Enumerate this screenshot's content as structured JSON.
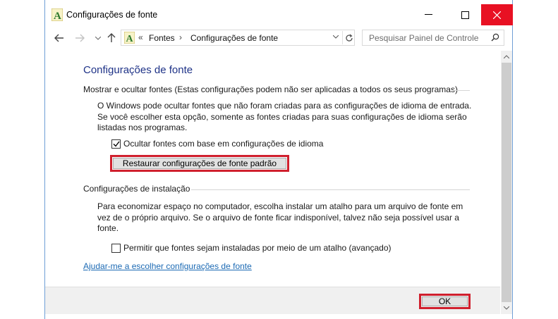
{
  "window": {
    "title": "Configurações de fonte"
  },
  "nav": {
    "back_icon": "arrow-left-icon",
    "forward_icon": "arrow-right-icon",
    "up_icon": "arrow-up-icon",
    "breadcrumb_prefix": "«",
    "breadcrumb": [
      "Fontes",
      "Configurações de fonte"
    ],
    "breadcrumb_separator": "›",
    "search_placeholder": "Pesquisar Painel de Controle"
  },
  "main": {
    "page_title": "Configurações de fonte",
    "section1": {
      "heading": "Mostrar e ocultar fontes (Estas configurações podem não ser aplicadas a todos os seus programas)",
      "description": "O Windows pode ocultar fontes que não foram criadas para as configurações de idioma de entrada. Se você escolher esta opção, somente as fontes criadas para suas configurações de idioma serão listadas nos programas.",
      "checkbox_label": "Ocultar fontes com base em configurações de idioma",
      "checkbox_checked": true,
      "restore_button": "Restaurar configurações de fonte padrão"
    },
    "section2": {
      "heading": "Configurações de instalação",
      "description": "Para economizar espaço no computador, escolha instalar um atalho para um arquivo de fonte em vez de o próprio arquivo. Se o arquivo de fonte ficar indisponível, talvez não seja possível usar a fonte.",
      "checkbox_label": "Permitir que fontes sejam instaladas por meio de um atalho (avançado)",
      "checkbox_checked": false
    },
    "help_link": "Ajudar-me a escolher configurações de fonte"
  },
  "footer": {
    "ok_button": "OK"
  },
  "colors": {
    "title_blue": "#1e3287",
    "link_blue": "#1c6ab4",
    "close_red": "#e81123",
    "highlight_red": "#d0202e"
  }
}
